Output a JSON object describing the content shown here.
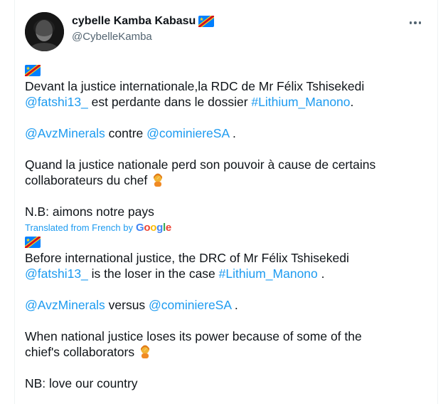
{
  "author": {
    "display_name": "cybelle Kamba Kabasu",
    "handle": "@CybelleKamba"
  },
  "tweet": {
    "original": {
      "line1": "Devant la justice internationale,la RDC de Mr Félix Tshisekedi",
      "line2_mention": "@fatshi13_",
      "line2_text": " est perdante dans le dossier ",
      "line2_hashtag": "#Lithium_Manono",
      "line2_end": ".",
      "line3_mention1": "@AvzMinerals",
      "line3_text": " contre ",
      "line3_mention2": "@cominiereSA",
      "line3_end": " .",
      "line4": "Quand la justice nationale perd son pouvoir à cause de certains",
      "line5": "collaborateurs du chef ",
      "line6": "N.B: aimons notre pays"
    },
    "translation_label": "Translated from French by",
    "translation_provider": "Google",
    "translated": {
      "line1": "Before international justice, the DRC of Mr Félix Tshisekedi",
      "line2_mention": "@fatshi13_",
      "line2_text": " is the loser in the case ",
      "line2_hashtag": "#Lithium_Manono",
      "line2_end": " .",
      "line3_mention1": "@AvzMinerals",
      "line3_text": " versus ",
      "line3_mention2": "@cominiereSA",
      "line3_end": " .",
      "line4": "When national justice loses its power because of some of the",
      "line5": "chief's collaborators ",
      "line6": "NB: love our country"
    }
  },
  "colors": {
    "link": "#1d9bf0",
    "secondary_text": "#536471",
    "flag_blue": "#007fff",
    "flag_yellow": "#f7d618",
    "flag_red": "#ce1021"
  }
}
